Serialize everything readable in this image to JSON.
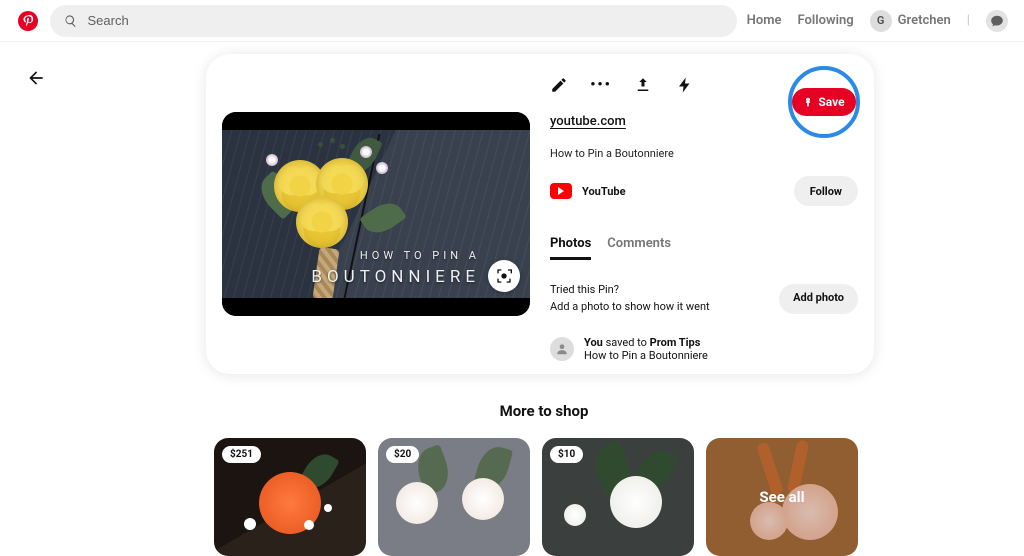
{
  "header": {
    "search_placeholder": "Search",
    "home": "Home",
    "following": "Following",
    "user_initial": "G",
    "user_name": "Gretchen"
  },
  "pin": {
    "source_link": "youtube.com",
    "title": "How to Pin a Boutonniere",
    "creator": "YouTube",
    "follow_label": "Follow",
    "save_label": "Save",
    "tabs": {
      "photos": "Photos",
      "comments": "Comments"
    },
    "tried_line1": "Tried this Pin?",
    "tried_line2": "Add a photo to show how it went",
    "add_photo_label": "Add photo",
    "saved": {
      "you_label": "You",
      "saved_to_text": " saved to ",
      "board": "Prom Tips",
      "subtitle": "How to Pin a Boutonniere"
    },
    "overlay": {
      "line1": "HOW TO PIN A",
      "line2": "BOUTONNIERE"
    }
  },
  "more": {
    "title": "More to shop",
    "see_all": "See all",
    "items": [
      {
        "price": "$251"
      },
      {
        "price": "$20"
      },
      {
        "price": "$10"
      }
    ]
  }
}
